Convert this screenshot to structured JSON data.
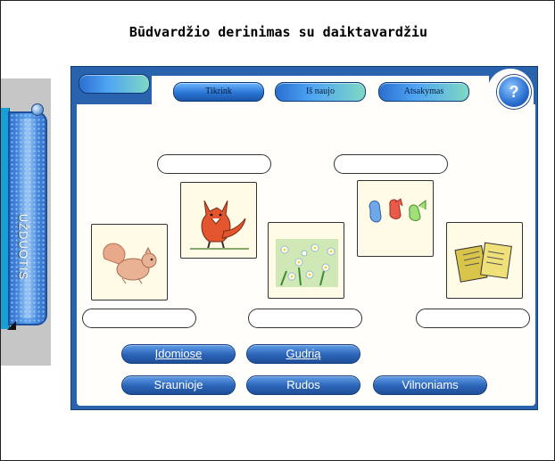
{
  "title": "Būdvardžio derinimas su daiktavardžiu",
  "side_tab": {
    "label": "UŽDUOTIS"
  },
  "toolbar": {
    "buttons": [
      "",
      "Tikrink",
      "Iš naujo",
      "Atsakymas"
    ],
    "help": "?"
  },
  "cards": [
    {
      "name": "squirrel",
      "icon": "squirrel-picture"
    },
    {
      "name": "fox",
      "icon": "fox-picture"
    },
    {
      "name": "daisies",
      "icon": "daisy-field-picture"
    },
    {
      "name": "mittens",
      "icon": "mittens-picture"
    },
    {
      "name": "books",
      "icon": "books-picture"
    }
  ],
  "words": [
    "Įdomiose",
    "Gudrią",
    "Sraunioje",
    "Rudos",
    "Vilnoniams"
  ],
  "colors": {
    "panel": "#2a63ad",
    "button": "#2b64b8",
    "card_bg": "#fffbe6"
  }
}
